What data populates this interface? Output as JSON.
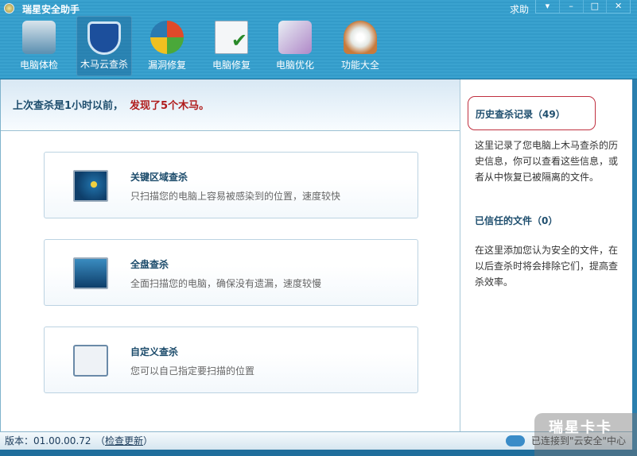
{
  "window": {
    "title": "瑞星安全助手",
    "help": "求助",
    "buttons": [
      "▾",
      "–",
      "□",
      "✕"
    ]
  },
  "toolbar": [
    {
      "label": "电脑体检",
      "color": "#5a8fb0"
    },
    {
      "label": "木马云查杀",
      "color": "#1c4f9c"
    },
    {
      "label": "漏洞修复",
      "color": "#2a7ab0"
    },
    {
      "label": "电脑修复",
      "color": "#e8eef2"
    },
    {
      "label": "电脑优化",
      "color": "#b088c8"
    },
    {
      "label": "功能大全",
      "color": "#c87a3c"
    }
  ],
  "header": {
    "status": "上次查杀是1小时以前，",
    "alert": "发现了5个木马。"
  },
  "cards": [
    {
      "title": "关键区域查杀",
      "desc": "只扫描您的电脑上容易被感染到的位置，速度较快"
    },
    {
      "title": "全盘查杀",
      "desc": "全面扫描您的电脑，确保没有遗漏，速度较慢"
    },
    {
      "title": "自定义查杀",
      "desc": "您可以自己指定要扫描的位置"
    }
  ],
  "sidebar": {
    "history_title": "历史查杀记录（49）",
    "history_desc": "这里记录了您电脑上木马查杀的历史信息，你可以查看这些信息，或者从中恢复已被隔离的文件。",
    "trusted_title": "已信任的文件（0）",
    "trusted_desc": "在这里添加您认为安全的文件，在以后查杀时将会排除它们，提高查杀效率。"
  },
  "statusbar": {
    "version": "版本：01.00.00.72",
    "update_open": "（",
    "update_link": "检查更新",
    "update_close": "）",
    "connection": "已连接到\"云安全\"中心"
  },
  "watermark": "瑞星卡卡"
}
